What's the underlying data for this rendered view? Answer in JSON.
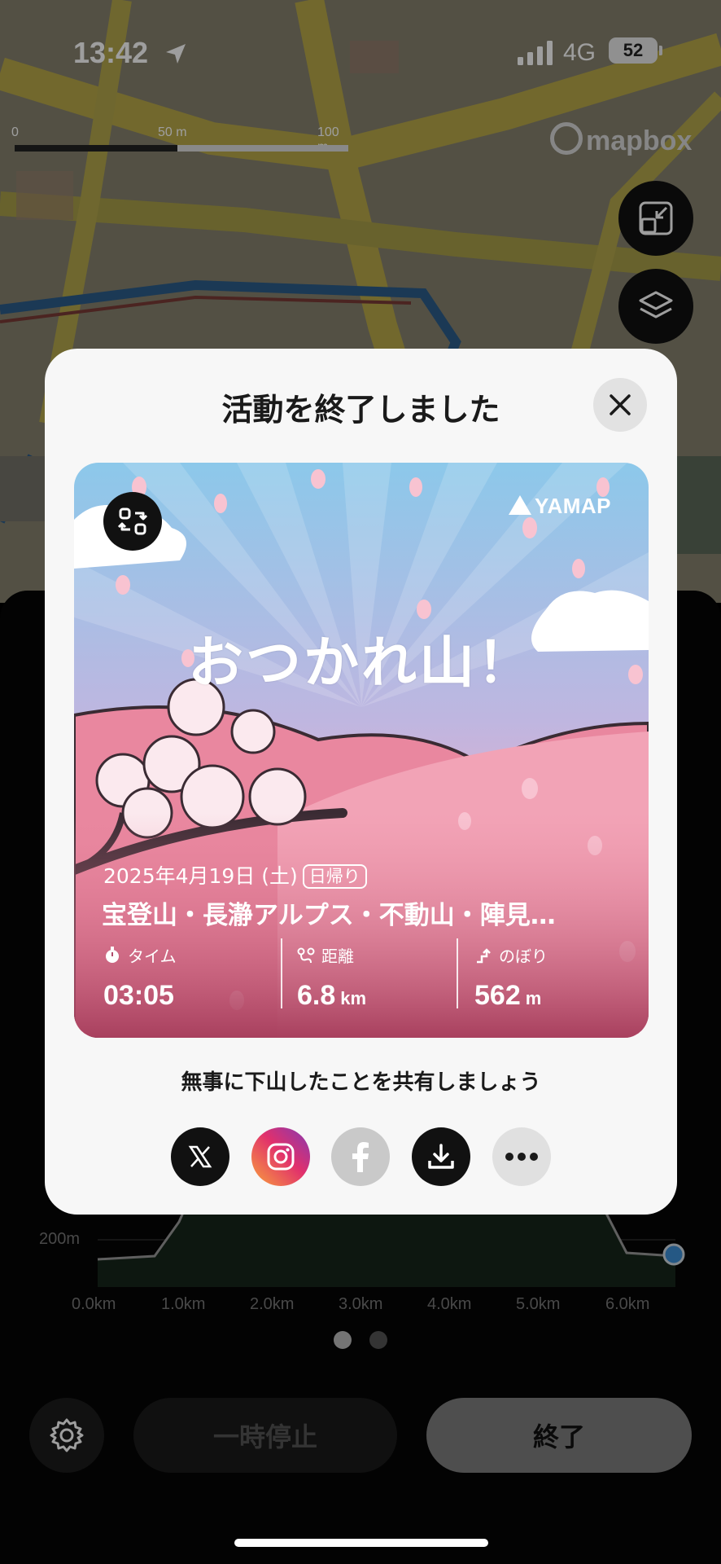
{
  "status_bar": {
    "time": "13:42",
    "network": "4G",
    "battery": "52"
  },
  "map": {
    "scale_labels": [
      "0",
      "50 m",
      "100 m"
    ],
    "attribution": "mapbox",
    "buttons": [
      "collapse-icon",
      "layers-icon"
    ]
  },
  "modal": {
    "title": "活動を終了しました",
    "card": {
      "brand": "YAMAP",
      "headline": "おつかれ山！",
      "date": "2025年4月19日 (土)",
      "trip_type": "日帰り",
      "route": "宝登山・長瀞アルプス・不動山・陣見…",
      "stats": [
        {
          "icon": "stopwatch-icon",
          "label": "タイム",
          "value": "03:05",
          "unit": ""
        },
        {
          "icon": "route-icon",
          "label": "距離",
          "value": "6.8",
          "unit": "km"
        },
        {
          "icon": "ascent-icon",
          "label": "のぼり",
          "value": "562",
          "unit": "m"
        }
      ]
    },
    "share_prompt": "無事に下山したことを共有しましょう",
    "share_buttons": [
      "x-icon",
      "instagram-icon",
      "facebook-icon",
      "download-icon",
      "more-icon"
    ]
  },
  "panel": {
    "y_label": "200m",
    "x_ticks": [
      "0.0km",
      "1.0km",
      "2.0km",
      "3.0km",
      "4.0km",
      "5.0km",
      "6.0km"
    ],
    "page_count": 2,
    "active_page": 1,
    "pause_label": "一時停止",
    "end_label": "終了"
  },
  "colors": {
    "accent_blue": "#3d8fd6",
    "modal_bg": "#f7f7f7",
    "instagram_gradient": [
      "#f9a23b",
      "#e1306c",
      "#833ab4"
    ]
  }
}
